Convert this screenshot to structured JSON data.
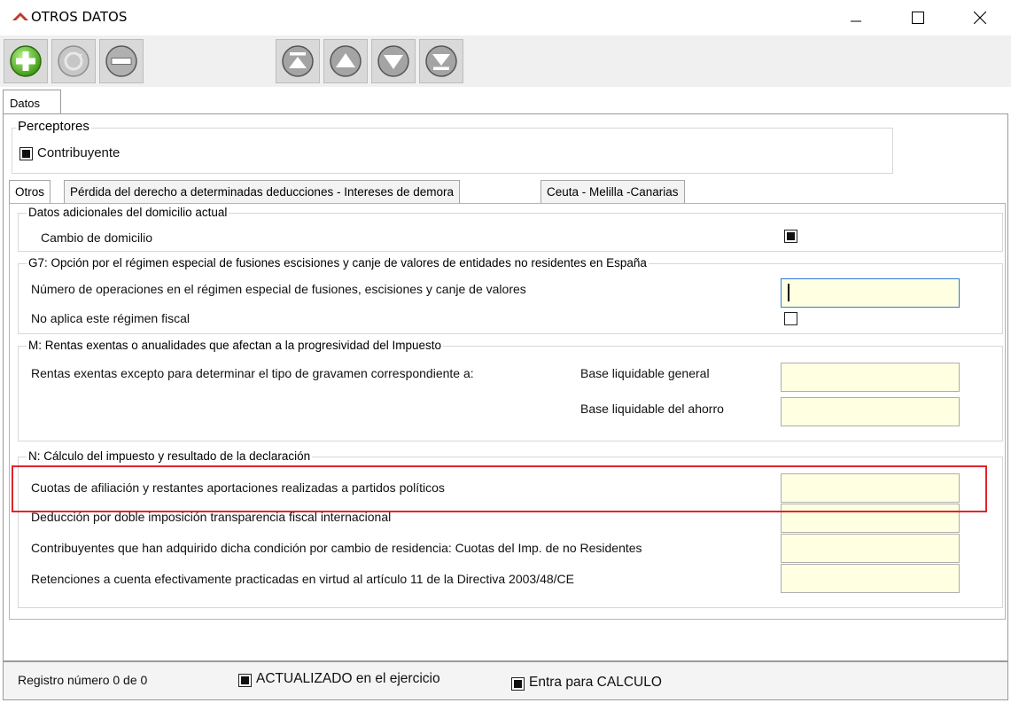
{
  "window": {
    "title": "OTROS DATOS",
    "colors": {
      "logo": "#c0392b",
      "highlight": "#e0242c",
      "field": "#ffffe1"
    }
  },
  "toolbar": {
    "buttons": [
      {
        "name": "add",
        "icon": "plus-circle-icon"
      },
      {
        "name": "refresh",
        "icon": "refresh-circle-icon"
      },
      {
        "name": "remove",
        "icon": "minus-circle-icon"
      },
      {
        "name": "first",
        "icon": "first-record-icon"
      },
      {
        "name": "previous",
        "icon": "previous-record-icon"
      },
      {
        "name": "next",
        "icon": "next-record-icon"
      },
      {
        "name": "last",
        "icon": "last-record-icon"
      }
    ]
  },
  "main_tab": {
    "label": "Datos"
  },
  "perceptores": {
    "legend": "Perceptores",
    "contribuyente_label": "Contribuyente",
    "contribuyente_checked": true
  },
  "sub_tabs": [
    {
      "label": "Otros",
      "active": true
    },
    {
      "label": "Pérdida del derecho a determinadas deducciones - Intereses de demora",
      "active": false
    },
    {
      "label": "Ceuta - Melilla -Canarias",
      "active": false
    }
  ],
  "domicilio": {
    "legend": "Datos adicionales del domicilio actual",
    "cambio_label": "Cambio de domicilio",
    "cambio_checked": true
  },
  "g7": {
    "legend": "G7: Opción por el régimen especial de fusiones escisiones y canje de valores de entidades no residentes en España",
    "num_operaciones_label": "Número de operaciones en el régimen especial de fusiones, escisiones y canje de valores",
    "num_operaciones_value": "",
    "no_aplica_label": "No aplica este régimen fiscal",
    "no_aplica_checked": false
  },
  "m": {
    "legend": "M: Rentas exentas o anualidades que afectan a la progresividad del Impuesto",
    "rentas_label": "Rentas exentas excepto para determinar el tipo de gravamen correspondiente a:",
    "base_general_label": "Base liquidable general",
    "base_general_value": "",
    "base_ahorro_label": "Base liquidable del ahorro",
    "base_ahorro_value": ""
  },
  "n": {
    "legend": "N: Cálculo del impuesto y resultado de la declaración",
    "rows": [
      {
        "label": "Cuotas de afiliación y restantes aportaciones realizadas a partidos políticos",
        "value": ""
      },
      {
        "label": "Deducción por doble imposición transparencia fiscal internacional",
        "value": ""
      },
      {
        "label": "Contribuyentes que han adquirido dicha condición por cambio de residencia: Cuotas del Imp. de no Residentes",
        "value": ""
      },
      {
        "label": "Retenciones a cuenta efectivamente practicadas en virtud al artículo 11 de la Directiva 2003/48/CE",
        "value": ""
      }
    ]
  },
  "status": {
    "registro": "Registro número 0 de 0",
    "actualizado_label": "ACTUALIZADO en el ejercicio",
    "actualizado_checked": true,
    "calculo_label": "Entra para CALCULO",
    "calculo_checked": true
  }
}
